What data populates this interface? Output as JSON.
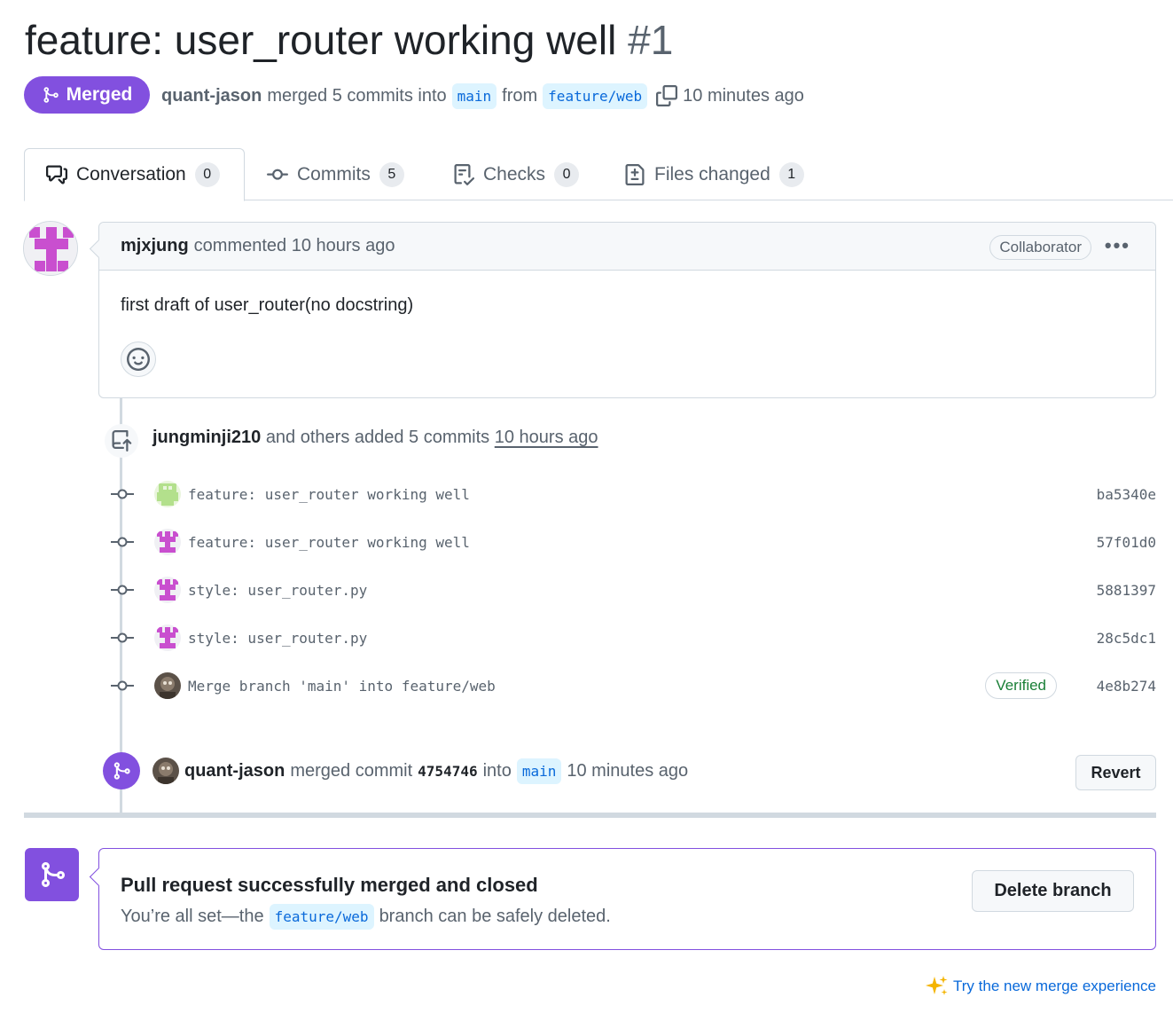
{
  "pr": {
    "title": "feature: user_router working well",
    "number": "#1",
    "state_label": "Merged",
    "merger": "quant-jason",
    "merge_text": "merged 5 commits into",
    "base_branch": "main",
    "from_text": "from",
    "head_branch": "feature/web",
    "time_ago": "10 minutes ago"
  },
  "tabs": [
    {
      "label": "Conversation",
      "count": "0",
      "icon": "comment-discussion-icon"
    },
    {
      "label": "Commits",
      "count": "5",
      "icon": "git-commit-icon"
    },
    {
      "label": "Checks",
      "count": "0",
      "icon": "checklist-icon"
    },
    {
      "label": "Files changed",
      "count": "1",
      "icon": "file-diff-icon"
    }
  ],
  "comment": {
    "author": "mjxjung",
    "action": "commented 10 hours ago",
    "role": "Collaborator",
    "menu": "•••",
    "body": "first draft of user_router(no docstring)"
  },
  "push_event": {
    "author": "jungminji210",
    "text": "and others added 5 commits",
    "time": "10 hours ago"
  },
  "commits": [
    {
      "message": "feature: user_router working well",
      "sha": "ba5340e",
      "verified": ""
    },
    {
      "message": "feature: user_router working well",
      "sha": "57f01d0",
      "verified": ""
    },
    {
      "message": "style: user_router.py",
      "sha": "5881397",
      "verified": ""
    },
    {
      "message": "style: user_router.py",
      "sha": "28c5dc1",
      "verified": ""
    },
    {
      "message": "Merge branch 'main' into feature/web",
      "sha": "4e8b274",
      "verified": "Verified"
    }
  ],
  "merge_event": {
    "author": "quant-jason",
    "text": "merged commit",
    "sha": "4754746",
    "into": "into",
    "branch": "main",
    "time": "10 minutes ago",
    "revert_label": "Revert"
  },
  "merged_box": {
    "title": "Pull request successfully merged and closed",
    "sub_prefix": "You’re all set—the",
    "branch": "feature/web",
    "sub_suffix": "branch can be safely deleted.",
    "delete_label": "Delete branch"
  },
  "footer": {
    "try_link": "Try the new merge experience"
  },
  "colors": {
    "merged_purple": "#8250df",
    "link_blue": "#0969da",
    "verified_green": "#1a7f37"
  }
}
